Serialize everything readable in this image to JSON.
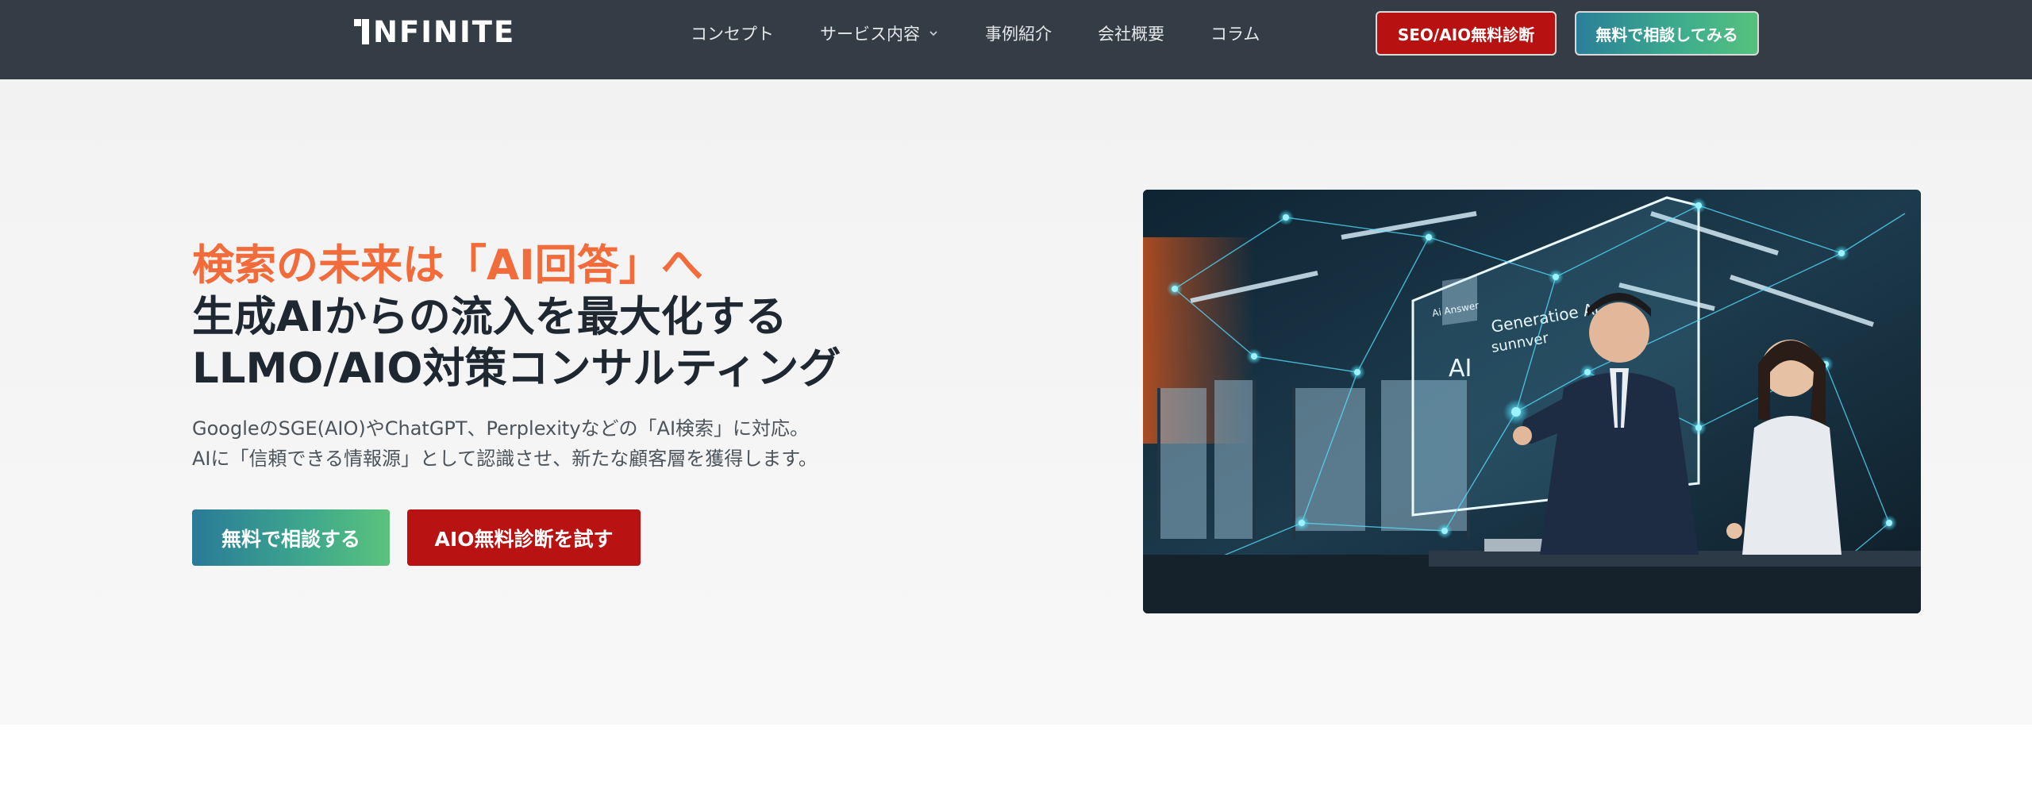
{
  "header": {
    "logo_text": "NFINITE",
    "nav": [
      {
        "label": "コンセプト"
      },
      {
        "label": "サービス内容"
      },
      {
        "label": "事例紹介"
      },
      {
        "label": "会社概要"
      },
      {
        "label": "コラム"
      }
    ],
    "btn_diagnosis": "SEO/AIO無料診断",
    "btn_consult": "無料で相談してみる"
  },
  "hero": {
    "headline_line1": "検索の未来は「AI回答」へ",
    "headline_line2": "生成AIからの流入を最大化する",
    "headline_line3": "LLMO/AIO対策コンサルティング",
    "sub_line1": "GoogleのSGE(AIO)やChatGPT、Perplexityなどの「AI検索」に対応。",
    "sub_line2": "AIに「信頼できる情報源」として認識させ、新たな顧客層を獲得します。",
    "btn_consult": "無料で相談する",
    "btn_diagnosis": "AIO無料診断を試す",
    "image": {
      "panel_badge": "AI",
      "panel_title": "Generatioe AI",
      "panel_subtitle": "sunnver",
      "panel_search": "Ai Answer"
    }
  },
  "colors": {
    "header_bg": "#343c45",
    "accent_orange": "#f26b3a",
    "red": "#b81111",
    "gradient_start": "#2a7f98",
    "gradient_end": "#56c17e"
  }
}
